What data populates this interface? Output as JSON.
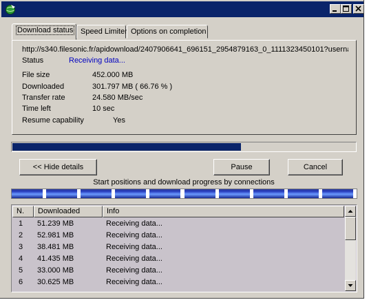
{
  "tabs": [
    {
      "label": "Download status"
    },
    {
      "label": "Speed Limiter"
    },
    {
      "label": "Options on completion"
    }
  ],
  "status": {
    "url": "http://s340.filesonic.fr/apidownload/2407906641_696151_2954879163_0_1111323450101?userna",
    "status_label": "Status",
    "status_value": "Receiving data...",
    "file_size_label": "File size",
    "file_size_value": "452.000  MB",
    "downloaded_label": "Downloaded",
    "downloaded_value": "301.797  MB  ( 66.76 % )",
    "transfer_rate_label": "Transfer rate",
    "transfer_rate_value": "24.580  MB/sec",
    "time_left_label": "Time left",
    "time_left_value": "10 sec",
    "resume_label": "Resume capability",
    "resume_value": "Yes"
  },
  "progress_fraction": 0.6676,
  "buttons": {
    "hide_details": "<< Hide details",
    "pause": "Pause",
    "cancel": "Cancel"
  },
  "connections_caption": "Start positions and download progress by connections",
  "connections_progress": [
    0.9,
    0.9,
    0.9,
    0.9,
    0.9,
    0.9,
    0.9,
    0.9,
    0.9,
    0.9
  ],
  "table": {
    "headers": {
      "n": "N.",
      "downloaded": "Downloaded",
      "info": "Info"
    },
    "rows": [
      {
        "n": "1",
        "downloaded": "51.239  MB",
        "info": "Receiving data..."
      },
      {
        "n": "2",
        "downloaded": "52.981  MB",
        "info": "Receiving data..."
      },
      {
        "n": "3",
        "downloaded": "38.481  MB",
        "info": "Receiving data..."
      },
      {
        "n": "4",
        "downloaded": "41.435  MB",
        "info": "Receiving data..."
      },
      {
        "n": "5",
        "downloaded": "33.000  MB",
        "info": "Receiving data..."
      },
      {
        "n": "6",
        "downloaded": "30.625  MB",
        "info": "Receiving data..."
      }
    ]
  },
  "colors": {
    "titlebar": "#0a246a",
    "progress_fill": "#0a246a",
    "status_value": "#0000c0",
    "list_background": "#c9c3cb"
  },
  "icons": {
    "app": "idm-globe-icon",
    "minimize": "minimize-icon",
    "maximize": "maximize-icon",
    "close": "close-icon",
    "scroll_up": "scroll-up-arrow-icon",
    "scroll_down": "scroll-down-arrow-icon"
  }
}
